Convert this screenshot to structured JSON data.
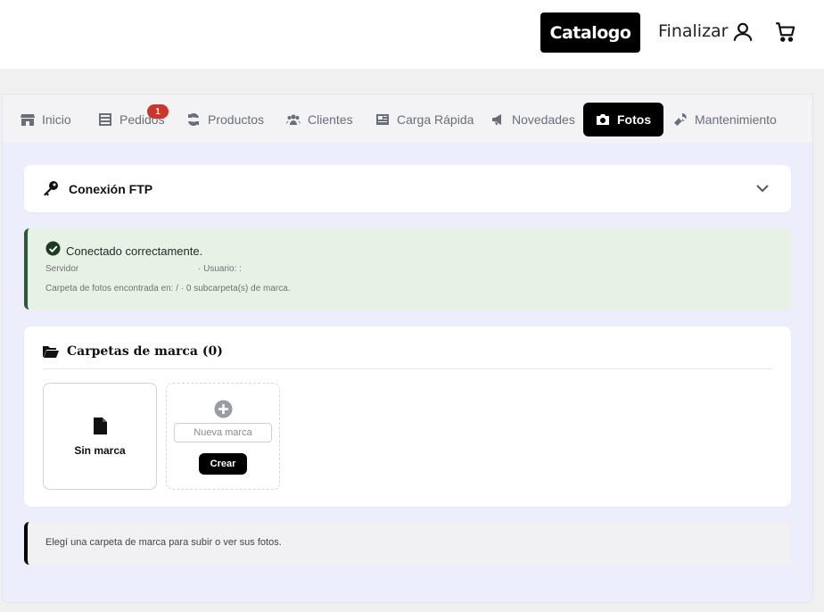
{
  "header": {
    "catalogo_label": "Catalogo",
    "finalizar_label": "Finalizar",
    "icons": [
      "user-icon",
      "cart-icon"
    ]
  },
  "tabs": [
    {
      "label": "Inicio",
      "icon": "store-icon"
    },
    {
      "label": "Pedidos",
      "icon": "list-icon",
      "badge": "1"
    },
    {
      "label": "Productos",
      "icon": "sync-icon"
    },
    {
      "label": "Clientes",
      "icon": "users-icon"
    },
    {
      "label": "Carga Rápida",
      "icon": "newspaper-icon"
    },
    {
      "label": "Novedades",
      "icon": "megaphone-icon"
    },
    {
      "label": "Fotos",
      "icon": "camera-icon",
      "active": true
    },
    {
      "label": "Mantenimiento",
      "icon": "wrench-icon"
    }
  ],
  "ftp": {
    "title": "Conexión FTP"
  },
  "status": {
    "title": "Conectado correctamente.",
    "servidor": "Servidor",
    "usuario": "· Usuario: :",
    "carpeta": "Carpeta de fotos encontrada en: /  ·  0 subcarpeta(s) de marca."
  },
  "folders": {
    "title": "Carpetas de marca (0)",
    "sin_marca_label": "Sin marca",
    "nueva_placeholder": "Nueva marca",
    "crear_label": "Crear"
  },
  "hint": {
    "text": "Elegí una carpeta de marca para subir o ver sus fotos."
  },
  "colors": {
    "accent": "#000000",
    "badge": "#c8372d",
    "success_border": "#2d5a36",
    "panel_bg": "#eceefc"
  }
}
